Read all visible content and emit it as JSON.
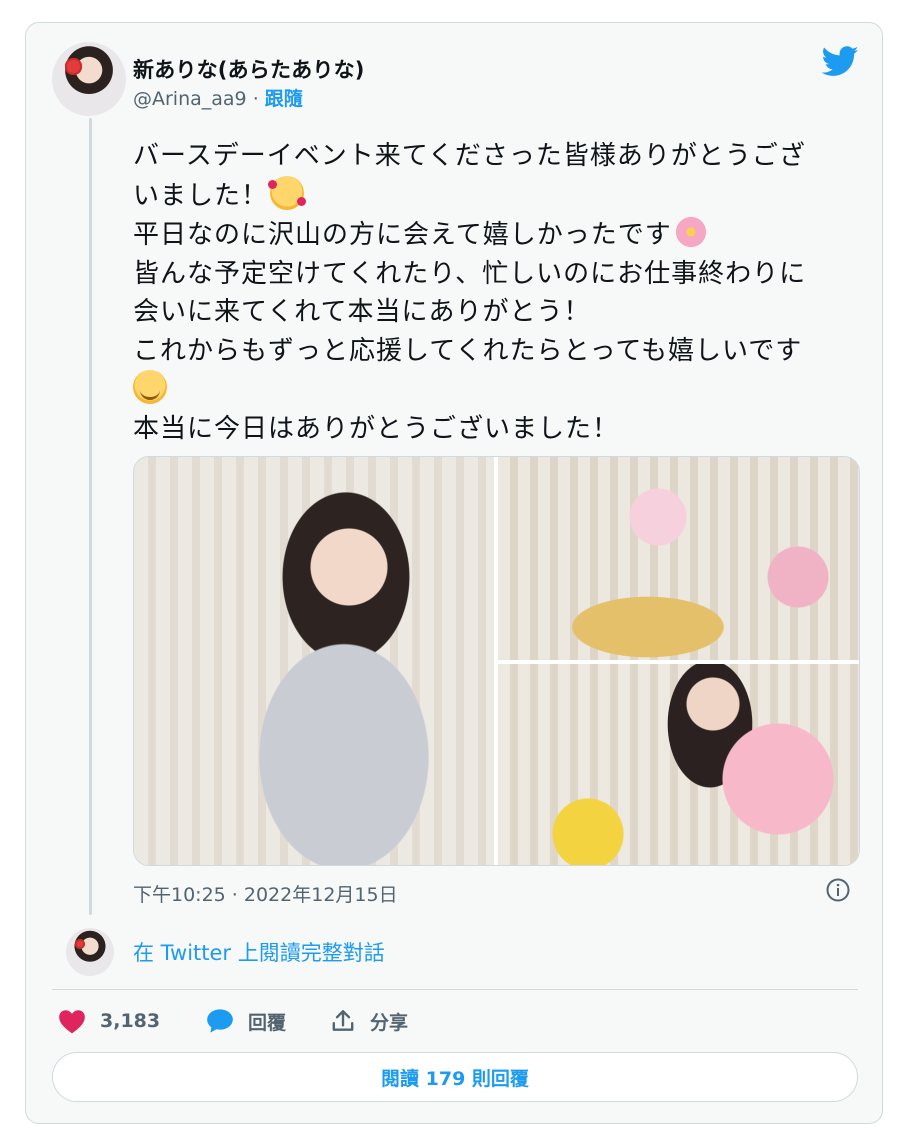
{
  "author": {
    "display_name": "新ありな(あらたありな)",
    "handle": "@Arina_aa9",
    "separator": "·",
    "follow_label": "跟隨"
  },
  "tweet": {
    "lines": [
      "バースデーイベント来てくださった皆様ありがとうござ",
      "いました！",
      "平日なのに沢山の方に会えて嬉しかったです",
      "皆んな予定空けてくれたり、忙しいのにお仕事終わりに",
      "会いに来てくれて本当にありがとう！",
      "これからもずっと応援してくれたらとっても嬉しいです",
      "",
      "本当に今日はありがとうございました！"
    ],
    "timestamp": "下午10:25 · 2022年12月15日"
  },
  "media": {
    "images": [
      {
        "alt": "photo-1"
      },
      {
        "alt": "photo-2"
      },
      {
        "alt": "photo-3"
      }
    ]
  },
  "conversation_link": "在 Twitter 上閱讀完整對話",
  "actions": {
    "like_count": "3,183",
    "reply_label": "回覆",
    "share_label": "分享"
  },
  "read_replies_label": "閱讀 179 則回覆",
  "colors": {
    "accent": "#1d9bf0",
    "like": "#e0245e",
    "border": "#cfd9de",
    "card_bg": "#f7f9f9"
  },
  "icons": [
    "twitter-bird-icon",
    "info-icon",
    "heart-icon",
    "reply-bubble-icon",
    "share-icon"
  ]
}
